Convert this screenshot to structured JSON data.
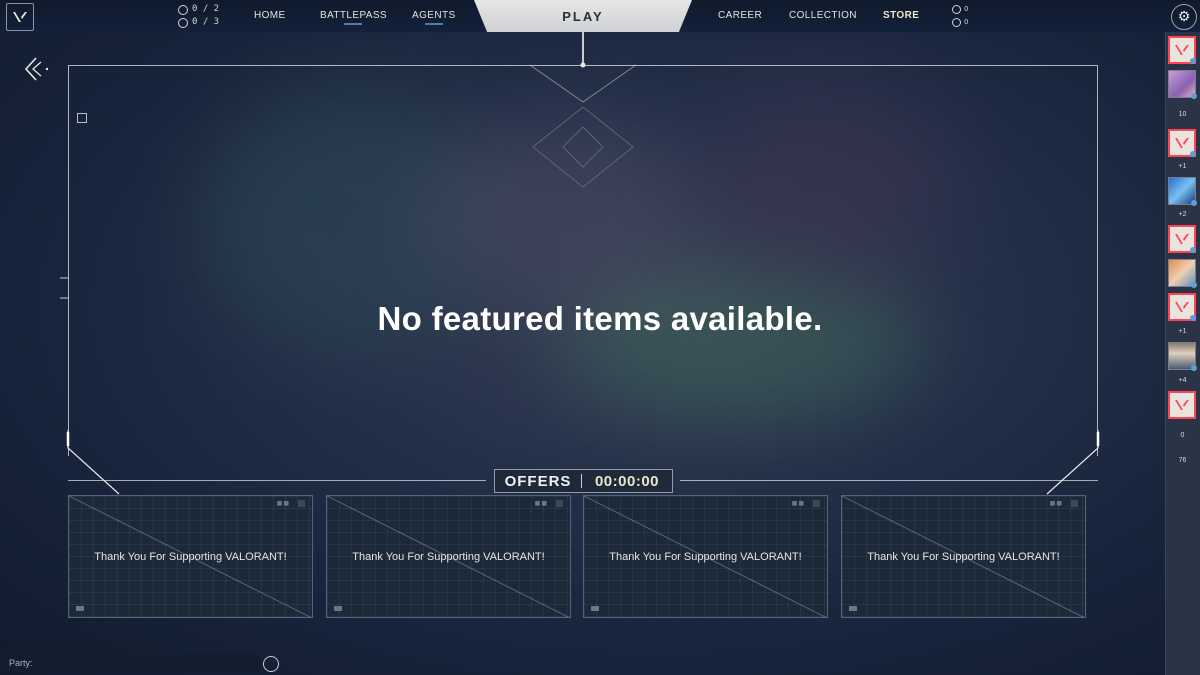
{
  "topbar": {
    "missions": [
      {
        "icon": "clock-icon",
        "text": "0 / 2"
      },
      {
        "icon": "plus-circle-icon",
        "text": "0 / 3"
      }
    ],
    "nav_left": [
      "HOME",
      "BATTLEPASS",
      "AGENTS"
    ],
    "play_label": "PLAY",
    "nav_right": [
      "CAREER",
      "COLLECTION",
      "STORE"
    ],
    "currency": [
      {
        "icon": "valorant-points-icon",
        "value": "0"
      },
      {
        "icon": "radianite-icon",
        "value": "0"
      }
    ]
  },
  "featured": {
    "message": "No featured items available."
  },
  "offers": {
    "title": "OFFERS",
    "timer": "00:00:00",
    "cards": [
      {
        "text": "Thank You For Supporting VALORANT!"
      },
      {
        "text": "Thank You For Supporting VALORANT!"
      },
      {
        "text": "Thank You For Supporting VALORANT!"
      },
      {
        "text": "Thank You For Supporting VALORANT!"
      }
    ]
  },
  "party": {
    "label": "Party:"
  },
  "sidebar": {
    "labels": [
      "10",
      "+1",
      "+2",
      "+1",
      "+4",
      "0",
      "76"
    ]
  },
  "colors": {
    "accent_red": "#fd4556",
    "store_active": "#f0e8c0",
    "timer": "#e9e5c8"
  }
}
